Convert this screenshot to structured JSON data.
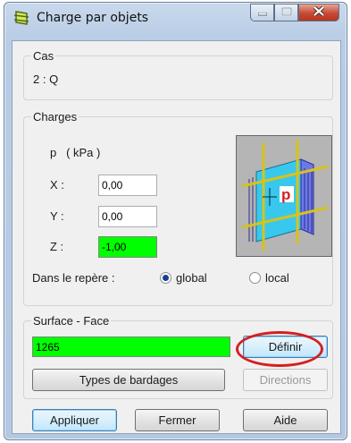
{
  "window": {
    "title": "Charge par objets",
    "controls": {
      "minimize": "minimize-icon",
      "maximize": "maximize-icon",
      "close": "close-icon"
    }
  },
  "cas": {
    "group_label": "Cas",
    "value": "2 : Q"
  },
  "charges": {
    "group_label": "Charges",
    "unit_label": "p   ( kPa )",
    "x_label": "X :",
    "x_value": "0,00",
    "y_label": "Y :",
    "y_value": "0,00",
    "z_label": "Z :",
    "z_value": "-1,00",
    "repere_label": "Dans le repère :",
    "option_global": "global",
    "option_local": "local",
    "selected_option": "global",
    "preview_icon": "load-on-panel-diagram-icon",
    "preview_letter": "p"
  },
  "surface": {
    "group_label": "Surface - Face",
    "value": "1265",
    "definir_label": "Définir",
    "types_label": "Types de bardages",
    "directions_label": "Directions"
  },
  "footer": {
    "apply_label": "Appliquer",
    "close_label": "Fermer",
    "help_label": "Aide"
  },
  "colors": {
    "highlight_field": "#00ff00",
    "annotation_oval": "#d61f1f",
    "close_button": "#c74a35"
  }
}
